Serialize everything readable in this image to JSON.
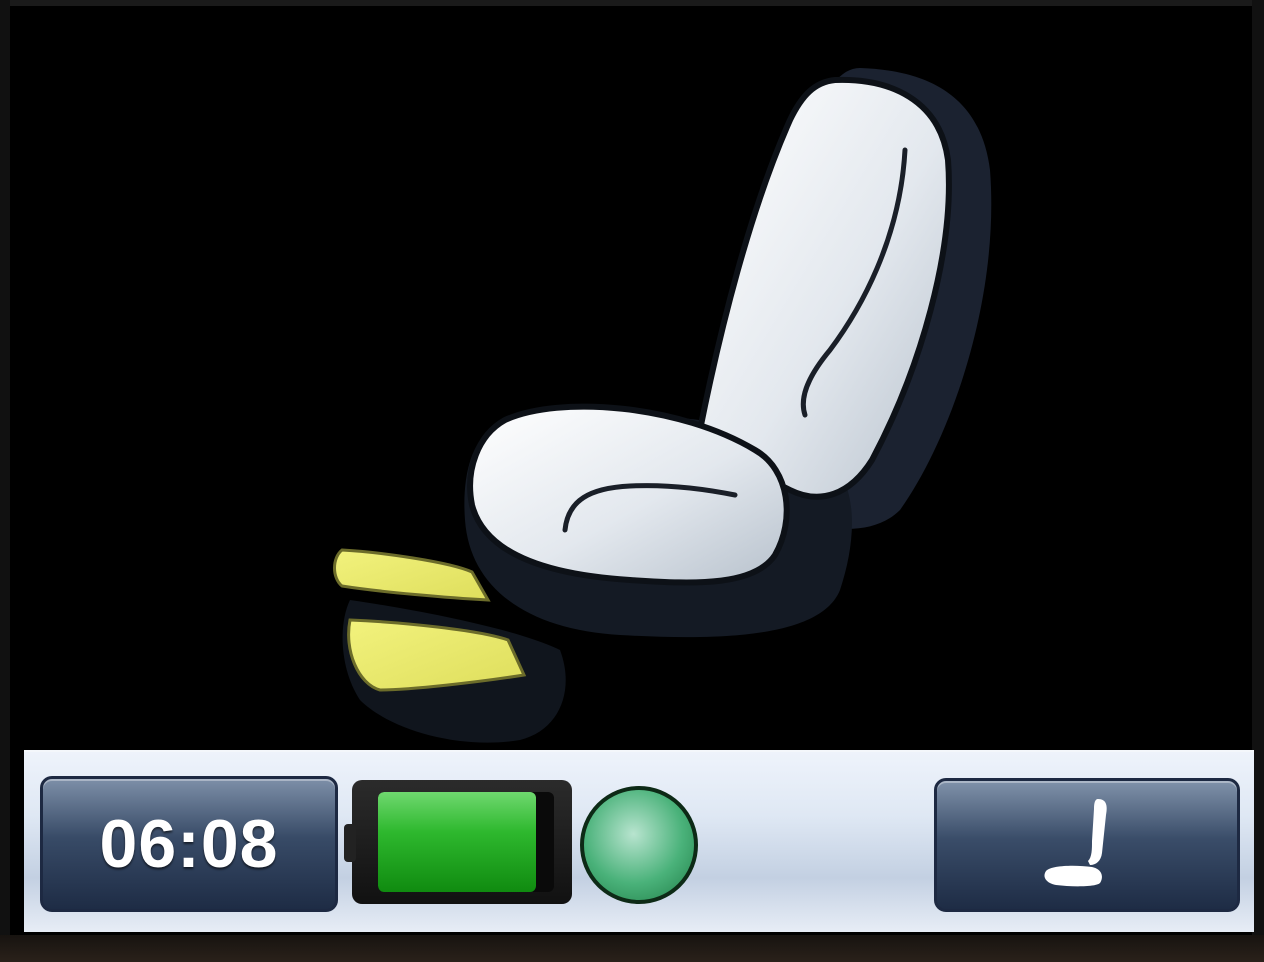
{
  "display": {
    "clock": "06:08",
    "battery_level": 0.9,
    "status_indicator": "green",
    "seat_button_icon": "seat-icon",
    "main_icon": "seat-adjust-illustration",
    "highlighted_part": "leg-rest",
    "colors": {
      "accent_yellow": "#ecec73",
      "battery_green": "#2eb82e",
      "panel_blue": "#2c3d5a",
      "seat_white": "#e6eaf0"
    }
  }
}
